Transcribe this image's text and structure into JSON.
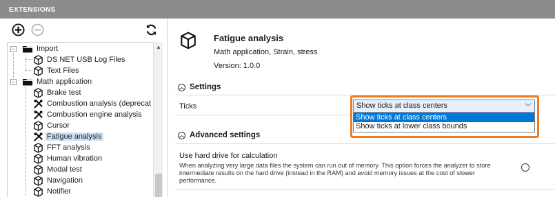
{
  "header": {
    "title": "EXTENSIONS"
  },
  "toolbar": {
    "add_icon": "plus-circle-icon",
    "remove_icon": "minus-circle-icon",
    "refresh_icon": "refresh-icon"
  },
  "tree": {
    "items": [
      {
        "label": "Import",
        "icon": "folder-icon",
        "expanded": true
      },
      {
        "label": "DS NET USB Log Files",
        "icon": "package-icon"
      },
      {
        "label": "Text Files",
        "icon": "package-icon"
      },
      {
        "label": "Math application",
        "icon": "folder-icon",
        "expanded": true
      },
      {
        "label": "Brake test",
        "icon": "package-icon"
      },
      {
        "label": "Combustion analysis (deprecat",
        "icon": "tools-icon"
      },
      {
        "label": "Combustion engine analysis",
        "icon": "tools-icon"
      },
      {
        "label": "Cursor",
        "icon": "package-icon"
      },
      {
        "label": "Fatigue analysis",
        "icon": "tools-icon",
        "selected": true
      },
      {
        "label": "FFT analysis",
        "icon": "package-icon"
      },
      {
        "label": "Human vibration",
        "icon": "package-icon"
      },
      {
        "label": "Modal test",
        "icon": "package-icon"
      },
      {
        "label": "Navigation",
        "icon": "package-icon"
      },
      {
        "label": "Notifier",
        "icon": "package-icon"
      }
    ]
  },
  "detail": {
    "title": "Fatigue analysis",
    "tags": "Math application, Strain, stress",
    "version": "Version: 1.0.0",
    "settings_header": "Settings",
    "ticks_label": "Ticks",
    "ticks_value": "Show ticks at class centers",
    "ticks_options": [
      "Show ticks at class centers",
      "Show ticks at lower class bounds"
    ],
    "advanced_header": "Advanced settings",
    "hard_drive_title": "Use hard drive for calculation",
    "hard_drive_desc": "When analyzing very large data files the system can run out of memory. This option forces the analyzer to store intermediate results on the hard drive (instead in the RAM) and avoid memory issues at the cost of slower performance."
  },
  "colors": {
    "accent": "#f07b1e",
    "header_bg": "#8c8c8c",
    "selection": "#0078d7"
  }
}
